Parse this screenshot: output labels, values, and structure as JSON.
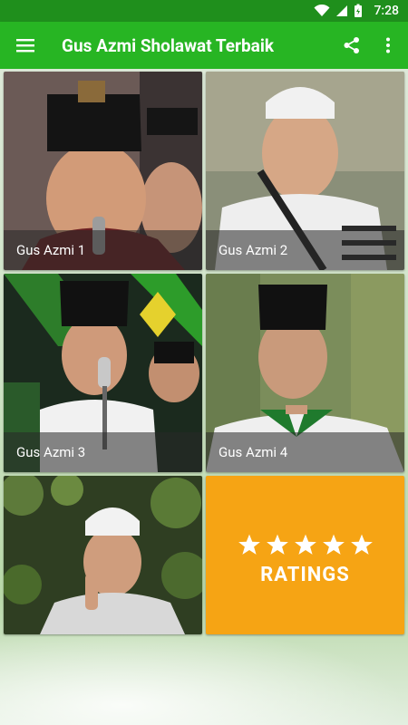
{
  "status_bar": {
    "time": "7:28"
  },
  "app_bar": {
    "title": "Gus Azmi Sholawat Terbaik"
  },
  "tiles": [
    {
      "caption": "Gus Azmi 1",
      "description": "Young man in black peci holding a microphone, smiling"
    },
    {
      "caption": "Gus Azmi 2",
      "description": "Young man in white cap and white shirt"
    },
    {
      "caption": "Gus Azmi 3",
      "description": "Young man in black peci singing into a microphone on stage"
    },
    {
      "caption": "Gus Azmi 4",
      "description": "Young man in black peci and green-white shirt"
    },
    {
      "caption": "",
      "description": "Young man in white cap making a peace sign under trees"
    }
  ],
  "ratings_tile": {
    "label": "RATINGS",
    "stars": 5
  },
  "colors": {
    "status_bar": "#1f8f1c",
    "app_bar": "#27b523",
    "ratings_bg": "#f6a414"
  }
}
